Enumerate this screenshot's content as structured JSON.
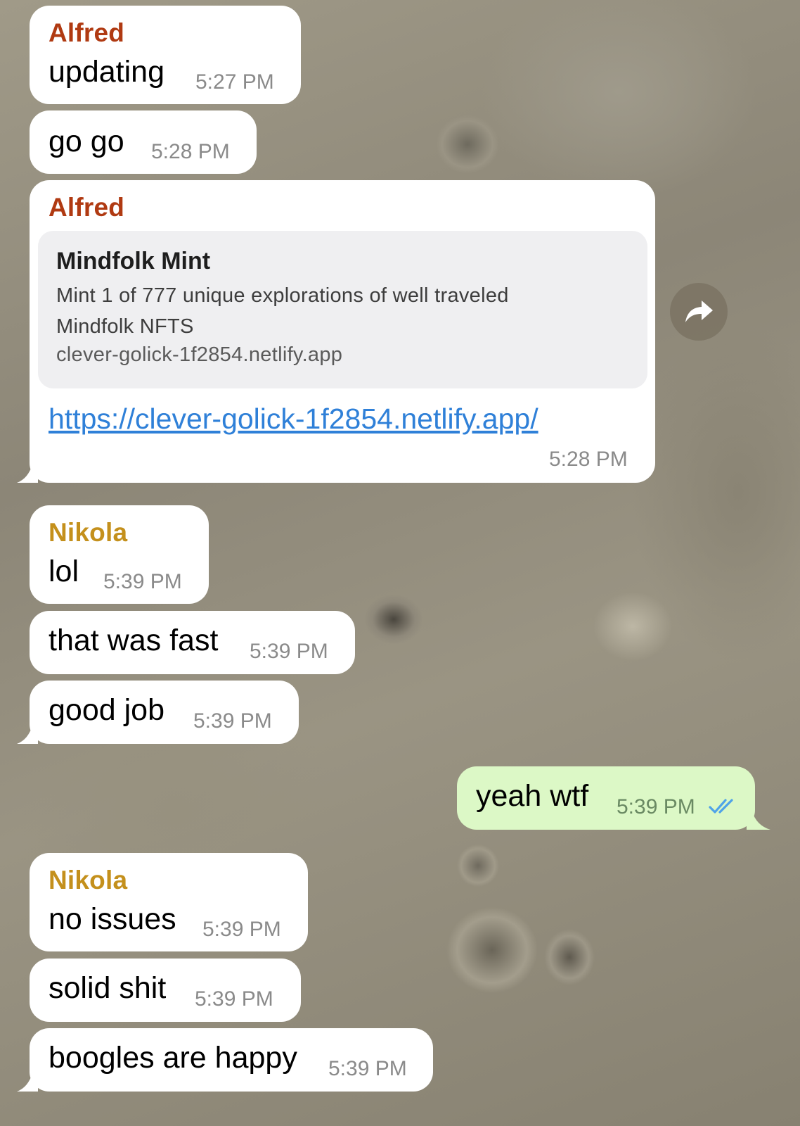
{
  "messages": [
    {
      "sender": "Alfred",
      "text": "updating",
      "time": "5:27 PM"
    },
    {
      "text": "go go",
      "time": "5:28 PM"
    },
    {
      "sender": "Alfred",
      "link_preview": {
        "title": "Mindfolk Mint",
        "description": "Mint 1 of 777 unique explorations of well traveled Mindfolk NFTS",
        "domain": "clever-golick-1f2854.netlify.app"
      },
      "link": "https://clever-golick-1f2854.netlify.app/",
      "time": "5:28 PM"
    },
    {
      "sender": "Nikola",
      "text": "lol",
      "time": "5:39 PM"
    },
    {
      "text": "that was fast",
      "time": "5:39 PM"
    },
    {
      "text": "good job",
      "time": "5:39 PM"
    },
    {
      "text": "yeah wtf",
      "time": "5:39 PM",
      "outgoing": true,
      "status": "read"
    },
    {
      "sender": "Nikola",
      "text": "no issues",
      "time": "5:39 PM"
    },
    {
      "text": "solid shit",
      "time": "5:39 PM"
    },
    {
      "text": "boogles are happy",
      "time": "5:39 PM"
    }
  ],
  "icons": {
    "share": "share-forward-icon",
    "read_receipt": "double-check-icon"
  },
  "colors": {
    "incoming_bubble": "#ffffff",
    "outgoing_bubble": "#dcf8c6",
    "alfred_name": "#b03a12",
    "nikola_name": "#c4901c",
    "link": "#2f80d8",
    "read_check": "#4fa3e8"
  }
}
